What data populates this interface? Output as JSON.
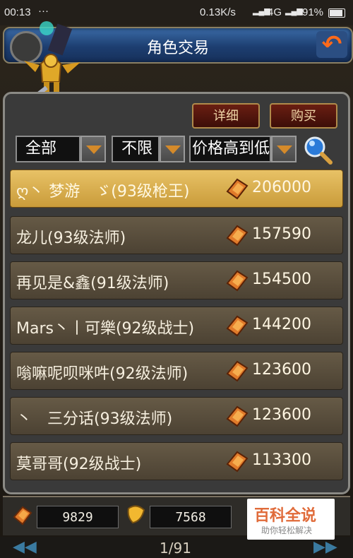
{
  "status_bar": {
    "time": "00:13",
    "dots": "···",
    "speed": "0.13K/s",
    "network": "4G",
    "battery": "91%"
  },
  "title": "角色交易",
  "buttons": {
    "detail": "详细",
    "buy": "购买"
  },
  "filters": {
    "category": "全部",
    "level": "不限",
    "sort": "价格高到低"
  },
  "listings": [
    {
      "name": "ღ丶 梦游　ゞ(93级枪王)",
      "price": "206000",
      "selected": true
    },
    {
      "name": "龙儿(93级法师)",
      "price": "157590",
      "selected": false
    },
    {
      "name": "再见是&鑫(91级法师)",
      "price": "154500",
      "selected": false
    },
    {
      "name": "Mars丶丨可樂(92级战士)",
      "price": "144200",
      "selected": false
    },
    {
      "name": "嗡嘛呢呗咪吽(92级法师)",
      "price": "123600",
      "selected": false
    },
    {
      "name": "丶　三分话(93级法师)",
      "price": "123600",
      "selected": false
    },
    {
      "name": "莫哥哥(92级战士)",
      "price": "113300",
      "selected": false
    }
  ],
  "currency": {
    "gold": "9829",
    "leaf": "7568"
  },
  "pager": {
    "prev": "◀◀",
    "page": "1/91",
    "next": "▶▶"
  },
  "watermark": {
    "line1": "百科全说",
    "line2": "助你轻松解决"
  },
  "colors": {
    "selected_row": "#e8c266",
    "row": "#665a46",
    "title_bar": "#2b5a96",
    "back_arrow": "#ff6a1a"
  }
}
